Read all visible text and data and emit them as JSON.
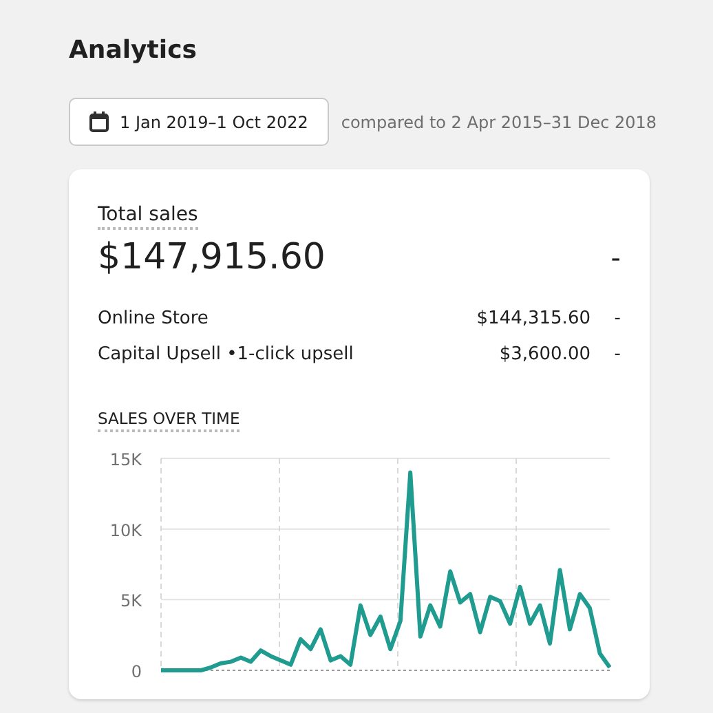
{
  "title": "Analytics",
  "date_range": {
    "label": "1 Jan 2019–1 Oct 2022"
  },
  "comparison": "compared to 2 Apr 2015–31 Dec 2018",
  "card": {
    "title": "Total sales",
    "total": "$147,915.60",
    "total_change": "-",
    "breakdown": [
      {
        "name": "Online Store",
        "value": "$144,315.60",
        "change": "-"
      },
      {
        "name": "Capital Upsell •1-click upsell",
        "value": "$3,600.00",
        "change": "-"
      }
    ],
    "chart": {
      "title": "SALES OVER TIME",
      "chart_data": {
        "type": "line",
        "grid": true,
        "ylim": [
          0,
          15000
        ],
        "yticks": [
          {
            "value": 0,
            "label": "0"
          },
          {
            "value": 5000,
            "label": "5K"
          },
          {
            "value": 10000,
            "label": "10K"
          },
          {
            "value": 15000,
            "label": "15K"
          }
        ],
        "series": [
          {
            "color": "#1f9b8f",
            "values": [
              0,
              0,
              0,
              0,
              0,
              200,
              500,
              600,
              900,
              600,
              1400,
              1000,
              700,
              400,
              2200,
              1500,
              2900,
              700,
              1000,
              400,
              4600,
              2500,
              3800,
              1500,
              3500,
              14000,
              2400,
              4600,
              3100,
              7000,
              4800,
              5400,
              2700,
              5200,
              4900,
              3300,
              5900,
              3300,
              4600,
              1900,
              7100,
              2900,
              5400,
              4400,
              1200,
              200
            ]
          }
        ]
      }
    }
  }
}
